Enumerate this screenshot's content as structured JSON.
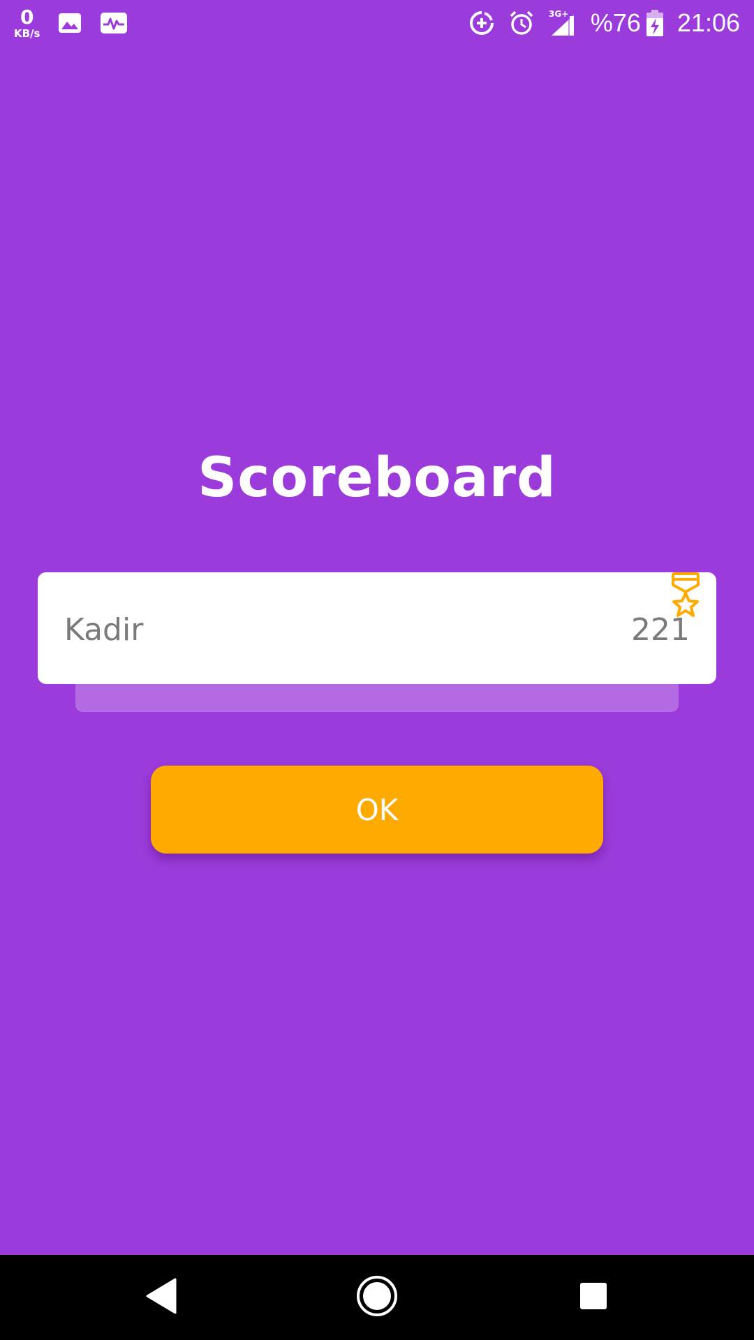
{
  "status_bar": {
    "net_speed_value": "0",
    "net_speed_unit": "KB/s",
    "battery_percent": "%76",
    "time": "21:06",
    "network_type": "3G+",
    "icons": [
      "gallery-icon",
      "activity-icon",
      "data-saver-icon",
      "alarm-icon",
      "signal-icon",
      "battery-charging-icon"
    ]
  },
  "scoreboard": {
    "title": "Scoreboard",
    "entries": [
      {
        "name": "Kadir",
        "score": "221",
        "icon": "medal-star-icon"
      }
    ]
  },
  "actions": {
    "ok_label": "OK"
  },
  "colors": {
    "background": "#9b3bdb",
    "card": "#ffffff",
    "card_shadow": "#b46ae2",
    "accent": "#ffaa00",
    "text_muted": "#7a7a7a"
  },
  "nav_bar": {
    "buttons": [
      "back-icon",
      "home-icon",
      "recents-icon"
    ]
  }
}
